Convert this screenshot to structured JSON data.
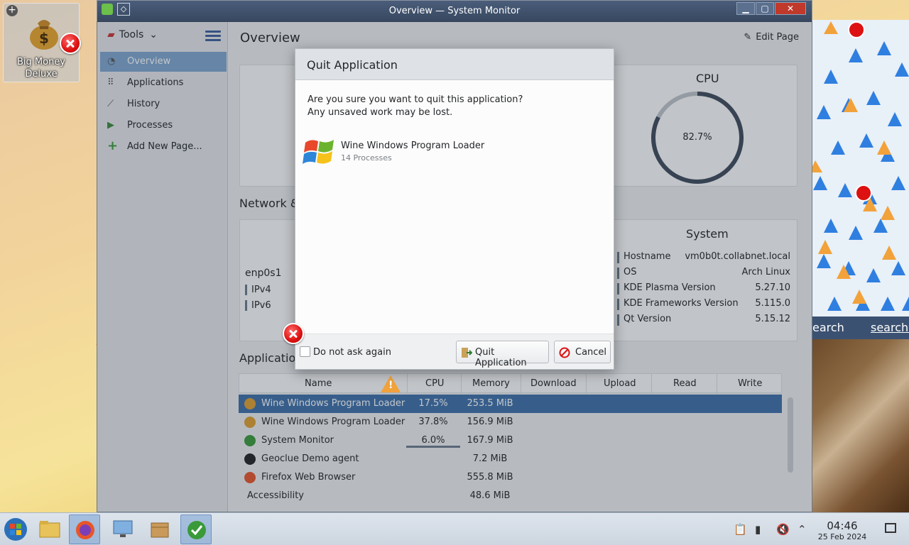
{
  "desktop": {
    "icon_label_1": "Big Money",
    "icon_label_2": "Deluxe"
  },
  "window": {
    "title": "Overview — System Monitor",
    "controls": {
      "minimize": "▁",
      "maximize": "▢",
      "close": "✕"
    }
  },
  "sidebar": {
    "tools_label": "Tools",
    "items": [
      {
        "label": "Overview",
        "icon": "gauge-icon"
      },
      {
        "label": "Applications",
        "icon": "grid-icon"
      },
      {
        "label": "History",
        "icon": "chart-icon"
      },
      {
        "label": "Processes",
        "icon": "play-icon"
      },
      {
        "label": "Add New Page...",
        "icon": "plus-icon"
      }
    ]
  },
  "content": {
    "page_title": "Overview",
    "edit_page": "Edit Page",
    "cpu_title": "CPU",
    "cpu_value": "82.7%",
    "cpu_fraction": 0.827,
    "network_title": "Network &",
    "interface": "enp0s1",
    "ipv4": "IPv4",
    "ipv6": "IPv6",
    "system_title": "System",
    "system_rows": [
      {
        "key": "Hostname",
        "value": "vm0b0t.collabnet.local"
      },
      {
        "key": "OS",
        "value": "Arch Linux"
      },
      {
        "key": "KDE Plasma Version",
        "value": "5.27.10"
      },
      {
        "key": "KDE Frameworks Version",
        "value": "5.115.0"
      },
      {
        "key": "Qt Version",
        "value": "5.15.12"
      }
    ],
    "applications_title": "Application",
    "table": {
      "headers": [
        "Name",
        "CPU",
        "Memory",
        "Download",
        "Upload",
        "Read",
        "Write"
      ],
      "rows": [
        {
          "name": "Wine Windows Program Loader",
          "cpu": "17.5%",
          "memory": "253.5 MiB"
        },
        {
          "name": "Wine Windows Program Loader",
          "cpu": "37.8%",
          "memory": "156.9 MiB"
        },
        {
          "name": "System Monitor",
          "cpu": "6.0%",
          "memory": "167.9 MiB"
        },
        {
          "name": "Geoclue Demo agent",
          "cpu": "",
          "memory": "7.2 MiB"
        },
        {
          "name": "Firefox Web Browser",
          "cpu": "",
          "memory": "555.8 MiB"
        },
        {
          "name": "Accessibility",
          "cpu": "",
          "memory": "48.6 MiB"
        }
      ]
    }
  },
  "dialog": {
    "title": "Quit Application",
    "message_line1": "Are you sure you want to quit this application?",
    "message_line2": "Any unsaved work may be lost.",
    "app_name": "Wine Windows Program Loader",
    "app_processes": "14 Processes",
    "checkbox_label": "Do not ask again",
    "quit_label": "Quit Application",
    "cancel_label": "Cancel"
  },
  "right_panel": {
    "search_left": "earch",
    "search_right": "search."
  },
  "taskbar": {
    "time": "04:46",
    "date": "25 Feb 2024"
  },
  "colors": {
    "accent": "#3d6fa8",
    "selection": "#7fa5cf",
    "warning": "#f2a23a",
    "error": "#d11111"
  }
}
